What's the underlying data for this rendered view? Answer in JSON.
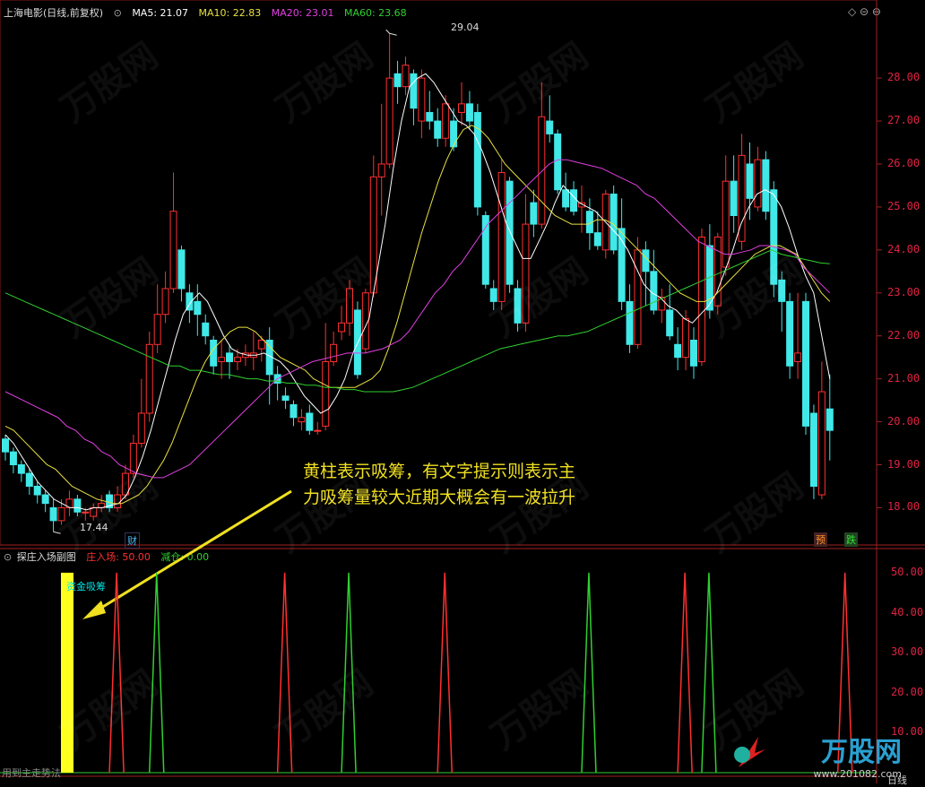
{
  "header": {
    "title": "上海电影(日线,前复权)",
    "ma5": "MA5: 21.07",
    "ma10": "MA10: 22.83",
    "ma20": "MA20: 23.01",
    "ma60": "MA60: 23.68"
  },
  "sub_header": {
    "title": "探庄入场副图",
    "zhuang": "庄入场: 50.00",
    "jiancang": "减仓: 0.00"
  },
  "annotations": {
    "high": "29.04",
    "low": "17.44",
    "note_line1": "黄柱表示吸筹，有文字提示则表示主",
    "note_line2": "力吸筹量较大近期大概会有一波拉升",
    "absorb_label": "资金吸筹",
    "cai": "财",
    "yu": "预",
    "die": "跌",
    "bottom_left": "用到主走势法",
    "bottom_right": "日线"
  },
  "logo": {
    "name": "万股网",
    "url": "www.201082.com"
  },
  "colors": {
    "up": "#ff3030",
    "down": "#40e8e8",
    "ma5": "#ffffff",
    "ma10": "#e8e040",
    "ma20": "#e040e0",
    "ma60": "#30d030"
  },
  "chart_data": [
    {
      "type": "candlestick",
      "title": "上海电影(日线,前复权)",
      "ylim": [
        17.3,
        29.4
      ],
      "yticks": [
        "28.00",
        "27.00",
        "26.00",
        "25.00",
        "24.00",
        "23.00",
        "22.00",
        "21.00",
        "20.00",
        "19.00",
        "18.00"
      ],
      "candles": [
        [
          19.6,
          19.3,
          19.7,
          19.1
        ],
        [
          19.3,
          19.0,
          19.4,
          18.8
        ],
        [
          19.0,
          18.8,
          19.1,
          18.6
        ],
        [
          18.8,
          18.5,
          18.9,
          18.3
        ],
        [
          18.5,
          18.3,
          18.6,
          18.1
        ],
        [
          18.3,
          18.1,
          18.4,
          17.9
        ],
        [
          18.0,
          17.7,
          18.2,
          17.44
        ],
        [
          17.7,
          18.0,
          18.2,
          17.6
        ],
        [
          18.0,
          18.2,
          18.4,
          17.8
        ],
        [
          18.2,
          17.9,
          18.3,
          17.8
        ],
        [
          17.9,
          17.9,
          18.0,
          17.7
        ],
        [
          17.8,
          18.0,
          18.1,
          17.7
        ],
        [
          18.0,
          18.1,
          18.3,
          17.9
        ],
        [
          18.3,
          18.0,
          18.4,
          17.9
        ],
        [
          18.0,
          18.3,
          18.5,
          17.9
        ],
        [
          18.3,
          18.8,
          19.0,
          18.2
        ],
        [
          18.8,
          19.5,
          19.7,
          18.7
        ],
        [
          19.5,
          20.2,
          21.0,
          19.4
        ],
        [
          20.2,
          21.8,
          22.1,
          20.0
        ],
        [
          21.8,
          22.5,
          23.2,
          21.6
        ],
        [
          22.5,
          23.1,
          23.5,
          22.3
        ],
        [
          23.1,
          24.9,
          25.8,
          23.0
        ],
        [
          24.0,
          23.1,
          24.1,
          22.8
        ],
        [
          23.0,
          22.6,
          23.2,
          22.3
        ],
        [
          22.8,
          22.5,
          23.2,
          22.0
        ],
        [
          22.3,
          22.0,
          22.5,
          21.8
        ],
        [
          21.9,
          21.3,
          22.0,
          21.1
        ],
        [
          21.4,
          21.5,
          21.9,
          21.0
        ],
        [
          21.6,
          21.4,
          21.8,
          21.0
        ],
        [
          21.4,
          21.5,
          21.7,
          21.2
        ],
        [
          21.5,
          21.6,
          21.8,
          21.3
        ],
        [
          21.5,
          21.6,
          22.1,
          21.2
        ],
        [
          21.7,
          21.9,
          22.0,
          21.4
        ],
        [
          21.9,
          21.1,
          22.2,
          20.4
        ],
        [
          21.1,
          20.9,
          21.3,
          20.5
        ],
        [
          20.6,
          20.5,
          20.8,
          20.3
        ],
        [
          20.4,
          20.1,
          20.5,
          19.9
        ],
        [
          20.0,
          20.1,
          20.3,
          19.8
        ],
        [
          20.2,
          19.8,
          20.4,
          19.7
        ],
        [
          19.8,
          19.8,
          20.0,
          19.7
        ],
        [
          19.9,
          21.4,
          22.3,
          19.8
        ],
        [
          21.4,
          21.8,
          22.1,
          21.3
        ],
        [
          22.1,
          22.3,
          22.7,
          21.9
        ],
        [
          22.3,
          23.1,
          23.3,
          22.0
        ],
        [
          22.6,
          21.1,
          22.8,
          21.0
        ],
        [
          21.7,
          23.0,
          23.1,
          21.6
        ],
        [
          23.0,
          25.7,
          26.2,
          22.9
        ],
        [
          25.7,
          26.0,
          27.4,
          24.8
        ],
        [
          26.0,
          28.0,
          29.04,
          25.9
        ],
        [
          28.1,
          27.8,
          28.4,
          27.4
        ],
        [
          27.8,
          28.3,
          28.5,
          27.6
        ],
        [
          28.1,
          27.3,
          28.2,
          26.9
        ],
        [
          27.0,
          28.0,
          28.2,
          26.6
        ],
        [
          27.2,
          27.0,
          27.7,
          26.8
        ],
        [
          27.0,
          26.6,
          27.3,
          26.4
        ],
        [
          26.6,
          27.4,
          27.6,
          26.4
        ],
        [
          27.0,
          26.4,
          27.3,
          26.3
        ],
        [
          27.2,
          27.4,
          27.9,
          26.9
        ],
        [
          27.4,
          27.0,
          27.7,
          26.8
        ],
        [
          27.2,
          25.0,
          27.4,
          24.8
        ],
        [
          24.8,
          23.2,
          24.9,
          23.1
        ],
        [
          23.1,
          22.8,
          23.3,
          22.6
        ],
        [
          22.8,
          25.8,
          26.1,
          22.6
        ],
        [
          25.6,
          23.2,
          25.7,
          23.0
        ],
        [
          23.1,
          22.3,
          23.3,
          22.1
        ],
        [
          22.3,
          24.6,
          25.3,
          22.1
        ],
        [
          25.1,
          24.6,
          25.4,
          24.3
        ],
        [
          24.6,
          27.1,
          27.9,
          24.5
        ],
        [
          27.0,
          26.7,
          27.6,
          26.5
        ],
        [
          26.7,
          25.4,
          26.8,
          25.3
        ],
        [
          25.4,
          25.0,
          25.8,
          24.9
        ],
        [
          25.4,
          24.9,
          25.6,
          24.8
        ],
        [
          25.0,
          25.1,
          25.5,
          24.4
        ],
        [
          24.9,
          24.4,
          25.2,
          24.0
        ],
        [
          24.4,
          24.1,
          24.9,
          24.0
        ],
        [
          24.0,
          25.3,
          25.4,
          23.8
        ],
        [
          25.3,
          24.0,
          25.5,
          23.9
        ],
        [
          24.5,
          22.8,
          25.2,
          22.6
        ],
        [
          22.8,
          21.8,
          23.2,
          21.6
        ],
        [
          21.8,
          24.0,
          24.3,
          21.7
        ],
        [
          24.0,
          23.5,
          24.2,
          22.7
        ],
        [
          23.5,
          22.6,
          24.0,
          22.5
        ],
        [
          22.6,
          22.9,
          23.1,
          22.3
        ],
        [
          22.6,
          22.0,
          23.2,
          21.9
        ],
        [
          21.8,
          21.5,
          22.2,
          21.2
        ],
        [
          21.5,
          22.4,
          22.6,
          21.2
        ],
        [
          21.9,
          21.3,
          22.2,
          21.0
        ],
        [
          21.4,
          24.3,
          24.5,
          21.3
        ],
        [
          24.1,
          22.6,
          24.6,
          22.4
        ],
        [
          22.7,
          24.3,
          24.4,
          22.5
        ],
        [
          23.6,
          25.6,
          26.2,
          23.4
        ],
        [
          25.6,
          24.8,
          26.2,
          24.4
        ],
        [
          24.2,
          26.2,
          26.7,
          24.0
        ],
        [
          26.0,
          25.2,
          26.5,
          24.7
        ],
        [
          25.0,
          26.1,
          26.4,
          24.9
        ],
        [
          26.1,
          24.9,
          26.3,
          24.7
        ],
        [
          25.4,
          23.2,
          25.6,
          22.9
        ],
        [
          23.3,
          22.8,
          23.5,
          22.1
        ],
        [
          22.8,
          21.3,
          23.0,
          21.0
        ],
        [
          21.4,
          21.6,
          23.0,
          21.0
        ],
        [
          22.8,
          19.9,
          23.0,
          19.7
        ],
        [
          20.2,
          18.5,
          20.4,
          18.2
        ],
        [
          18.3,
          20.7,
          21.4,
          18.2
        ],
        [
          20.3,
          19.8,
          21.1,
          19.1
        ]
      ],
      "series": [
        {
          "name": "MA5",
          "values": [
            19.7,
            19.5,
            19.2,
            18.9,
            18.6,
            18.4,
            18.2,
            18.1,
            18.0,
            18.0,
            17.95,
            18.0,
            18.0,
            18.05,
            18.1,
            18.3,
            18.7,
            19.2,
            19.8,
            20.5,
            21.2,
            21.9,
            22.5,
            22.8,
            23.0,
            22.8,
            22.4,
            22.0,
            21.7,
            21.6,
            21.55,
            21.55,
            21.6,
            21.5,
            21.4,
            21.2,
            20.9,
            20.6,
            20.4,
            20.2,
            20.3,
            20.6,
            21.0,
            21.6,
            22.0,
            22.4,
            23.5,
            24.6,
            25.9,
            27.0,
            27.8,
            28.0,
            28.1,
            27.9,
            27.6,
            27.3,
            27.0,
            26.9,
            26.7,
            26.3,
            25.8,
            25.2,
            24.6,
            24.2,
            23.8,
            23.8,
            24.2,
            24.6,
            25.1,
            25.5,
            25.3,
            25.1,
            25.0,
            24.9,
            24.7,
            24.5,
            24.3,
            24.0,
            23.6,
            23.2,
            23.0,
            22.9,
            22.7,
            22.6,
            22.4,
            22.3,
            22.5,
            22.7,
            23.0,
            23.5,
            24.0,
            24.6,
            25.0,
            25.3,
            25.4,
            25.3,
            25.0,
            24.5,
            23.9,
            23.4,
            23.0,
            22.0,
            21.0
          ]
        },
        {
          "name": "MA10",
          "values": [
            19.9,
            19.8,
            19.6,
            19.4,
            19.2,
            19.0,
            18.9,
            18.7,
            18.5,
            18.4,
            18.3,
            18.2,
            18.15,
            18.1,
            18.1,
            18.2,
            18.3,
            18.5,
            18.8,
            19.1,
            19.5,
            20.0,
            20.5,
            21.0,
            21.4,
            21.7,
            21.9,
            22.1,
            22.2,
            22.2,
            22.1,
            21.9,
            21.7,
            21.5,
            21.4,
            21.3,
            21.2,
            21.0,
            20.9,
            20.8,
            20.8,
            20.8,
            20.8,
            20.9,
            21.0,
            21.2,
            21.7,
            22.3,
            23.0,
            23.7,
            24.4,
            25.0,
            25.6,
            26.1,
            26.5,
            26.8,
            26.9,
            26.8,
            26.6,
            26.3,
            26.0,
            25.8,
            25.6,
            25.4,
            25.2,
            25.0,
            24.8,
            24.7,
            24.6,
            24.6,
            24.6,
            24.7,
            24.7,
            24.6,
            24.4,
            24.2,
            24.0,
            23.8,
            23.6,
            23.4,
            23.2,
            23.0,
            22.9,
            22.8,
            22.8,
            22.9,
            23.1,
            23.3,
            23.5,
            23.7,
            23.9,
            24.0,
            24.1,
            24.1,
            24.0,
            23.9,
            23.6,
            23.3,
            23.0,
            22.8
          ]
        },
        {
          "name": "MA20",
          "values": [
            20.7,
            20.6,
            20.5,
            20.4,
            20.3,
            20.2,
            20.1,
            19.9,
            19.8,
            19.6,
            19.5,
            19.3,
            19.2,
            19.0,
            18.9,
            18.8,
            18.75,
            18.7,
            18.7,
            18.8,
            18.9,
            19.0,
            19.2,
            19.4,
            19.6,
            19.8,
            20.0,
            20.2,
            20.4,
            20.6,
            20.8,
            21.0,
            21.1,
            21.2,
            21.3,
            21.4,
            21.45,
            21.5,
            21.55,
            21.6,
            21.6,
            21.6,
            21.65,
            21.7,
            21.8,
            21.9,
            22.1,
            22.4,
            22.7,
            23.0,
            23.2,
            23.5,
            23.7,
            24.0,
            24.3,
            24.6,
            24.8,
            25.0,
            25.2,
            25.4,
            25.6,
            25.8,
            26.0,
            26.1,
            26.1,
            26.05,
            26.0,
            25.95,
            25.9,
            25.8,
            25.7,
            25.6,
            25.5,
            25.3,
            25.2,
            25.0,
            24.8,
            24.6,
            24.4,
            24.2,
            24.1,
            24.0,
            23.9,
            23.9,
            23.95,
            24.0,
            24.1,
            24.1,
            24.05,
            24.0,
            23.9,
            23.6,
            23.4,
            23.2,
            23.0
          ]
        },
        {
          "name": "MA60",
          "values": [
            23.0,
            22.9,
            22.8,
            22.7,
            22.6,
            22.5,
            22.4,
            22.3,
            22.2,
            22.1,
            22.0,
            21.9,
            21.8,
            21.7,
            21.6,
            21.5,
            21.4,
            21.3,
            21.3,
            21.2,
            21.2,
            21.15,
            21.1,
            21.1,
            21.05,
            21.0,
            21.0,
            20.95,
            20.95,
            20.9,
            20.9,
            20.85,
            20.85,
            20.8,
            20.8,
            20.75,
            20.75,
            20.7,
            20.7,
            20.7,
            20.7,
            20.75,
            20.8,
            20.9,
            21.0,
            21.1,
            21.2,
            21.3,
            21.4,
            21.5,
            21.6,
            21.7,
            21.75,
            21.8,
            21.85,
            21.9,
            21.95,
            22.0,
            22.0,
            22.05,
            22.1,
            22.2,
            22.3,
            22.4,
            22.5,
            22.6,
            22.7,
            22.8,
            22.9,
            23.0,
            23.1,
            23.2,
            23.3,
            23.4,
            23.5,
            23.6,
            23.7,
            23.8,
            23.9,
            24.0,
            23.9,
            23.85,
            23.8,
            23.75,
            23.7,
            23.68
          ]
        }
      ]
    },
    {
      "type": "spikes",
      "title": "探庄入场副图",
      "ylim": [
        0,
        52
      ],
      "yticks": [
        "50.00",
        "40.00",
        "30.00",
        "20.00",
        "10.00"
      ],
      "red_spikes_index": [
        13,
        34,
        54,
        84,
        104
      ],
      "green_spikes_index": [
        18,
        42,
        72,
        87
      ],
      "spike_value": 50,
      "yellow_bar_index": 5
    }
  ]
}
